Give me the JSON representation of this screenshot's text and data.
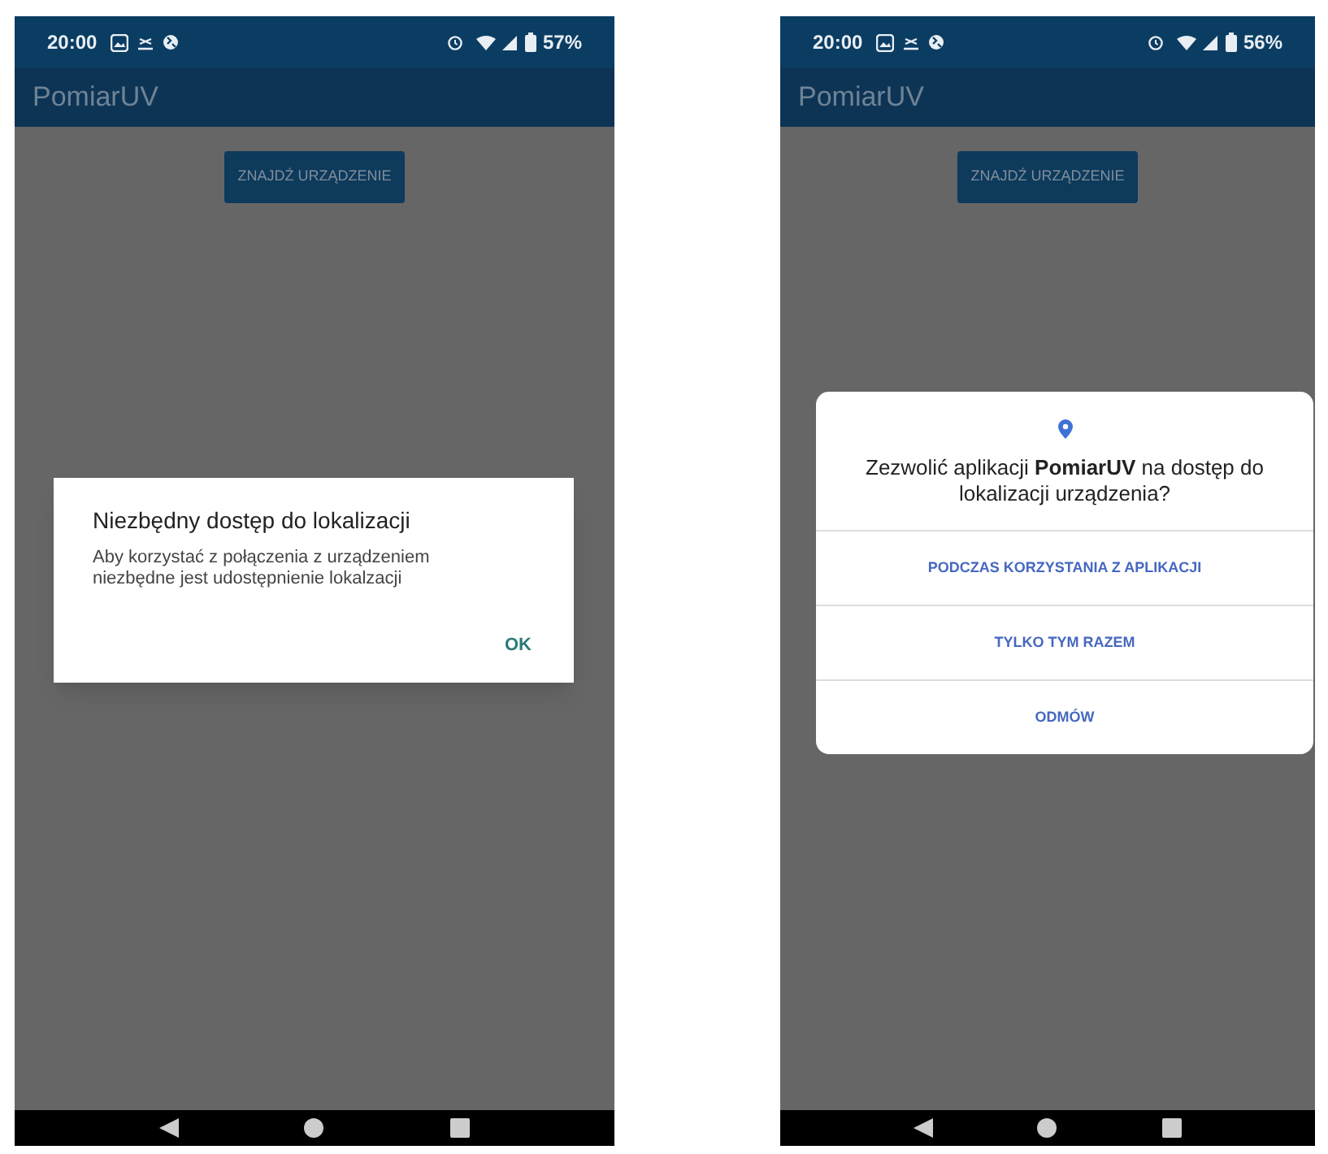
{
  "screens": [
    {
      "status_bar": {
        "time": "20:00",
        "battery": "57%"
      },
      "app_bar": {
        "title": "PomiarUV"
      },
      "button": "ZNAJDŹ URZĄDZENIE",
      "dialog": {
        "kind": "alert",
        "title": "Niezbędny dostęp do lokalizacji",
        "message": "Aby korzystać z połączenia z urządzeniem niezbędne jest udostępnienie lokalzacji",
        "actions": [
          "OK"
        ]
      }
    },
    {
      "status_bar": {
        "time": "20:00",
        "battery": "56%"
      },
      "app_bar": {
        "title": "PomiarUV"
      },
      "button": "ZNAJDŹ URZĄDZENIE",
      "dialog": {
        "kind": "permission",
        "title": "Zezwolić aplikacji **PomiarUV** na dostęp do lokalizacji urządzenia?",
        "actions": [
          "PODCZAS KORZYSTANIA Z APLIKACJI",
          "TYLKO TYM RAZEM",
          "ODMÓW"
        ]
      }
    }
  ]
}
